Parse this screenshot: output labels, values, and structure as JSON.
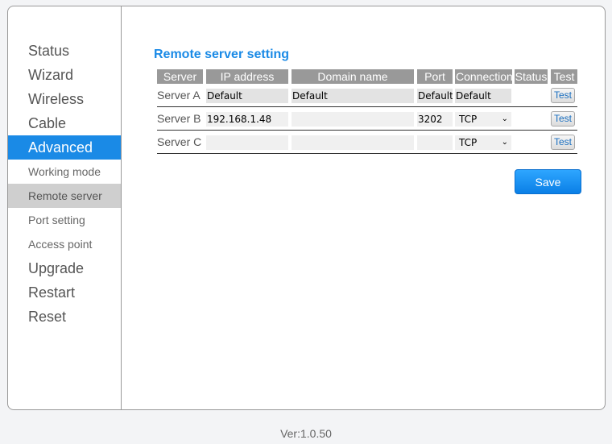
{
  "sidebar": {
    "items": [
      {
        "label": "Status"
      },
      {
        "label": "Wizard"
      },
      {
        "label": "Wireless"
      },
      {
        "label": "Cable"
      },
      {
        "label": "Advanced"
      },
      {
        "label": "Working mode"
      },
      {
        "label": "Remote server"
      },
      {
        "label": "Port setting"
      },
      {
        "label": "Access point"
      },
      {
        "label": "Upgrade"
      },
      {
        "label": "Restart"
      },
      {
        "label": "Reset"
      }
    ]
  },
  "main": {
    "title": "Remote server setting",
    "headers": [
      "Server",
      "IP address",
      "Domain name",
      "Port",
      "Connection",
      "Status",
      "Test"
    ],
    "rows": [
      {
        "server": "Server A",
        "ip": "Default",
        "domain": "Default",
        "port": "Default",
        "connection": "Default",
        "status": "",
        "test": "Test"
      },
      {
        "server": "Server B",
        "ip": "192.168.1.48",
        "domain": "",
        "port": "3202",
        "connection": "TCP",
        "status": "",
        "test": "Test"
      },
      {
        "server": "Server C",
        "ip": "",
        "domain": "",
        "port": "",
        "connection": "TCP",
        "status": "",
        "test": "Test"
      }
    ],
    "save_label": "Save"
  },
  "footer": {
    "version": "Ver:1.0.50"
  },
  "colors": {
    "accent": "#1a8ae6",
    "header_bg": "#999999",
    "selected_bg": "#cfcfcf"
  }
}
